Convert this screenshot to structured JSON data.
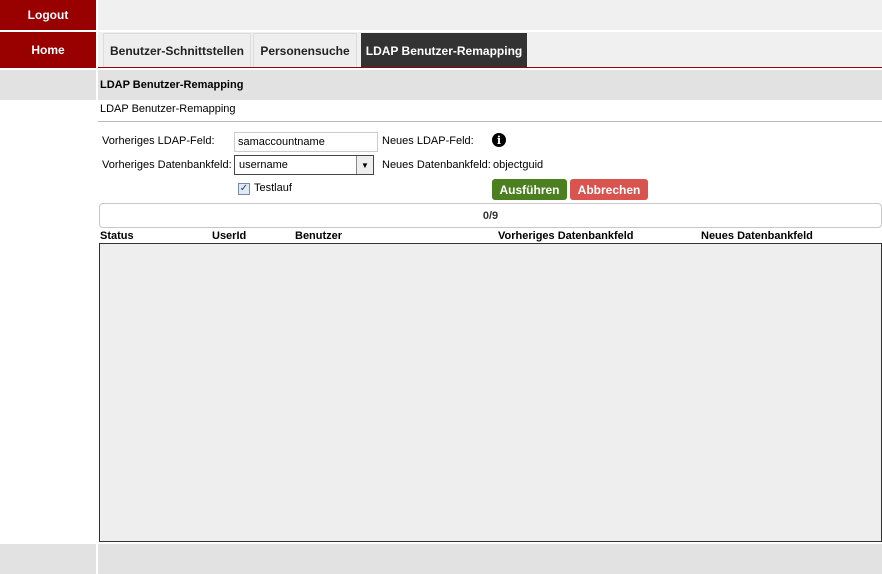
{
  "sidebar": {
    "logout_label": "Logout",
    "home_label": "Home"
  },
  "tabs": [
    {
      "label": "Benutzer-Schnittstellen",
      "active": false
    },
    {
      "label": "Personensuche",
      "active": false
    },
    {
      "label": "LDAP Benutzer-Remapping",
      "active": true
    }
  ],
  "page": {
    "header": "LDAP Benutzer-Remapping",
    "subtitle": "LDAP Benutzer-Remapping"
  },
  "form": {
    "prev_ldap_label": "Vorheriges LDAP-Feld:",
    "prev_ldap_value": "samaccountname",
    "new_ldap_label": "Neues LDAP-Feld:",
    "new_ldap_icon": "info-icon",
    "prev_db_label": "Vorheriges Datenbankfeld:",
    "prev_db_selected": "username",
    "new_db_label": "Neues Datenbankfeld:",
    "new_db_value": "objectguid",
    "testrun_label": "Testlauf",
    "testrun_checked": true,
    "run_label": "Ausführen",
    "cancel_label": "Abbrechen"
  },
  "progress": {
    "text": "0/9"
  },
  "results": {
    "columns": [
      "Status",
      "UserId",
      "Benutzer",
      "Vorheriges Datenbankfeld",
      "Neues Datenbankfeld"
    ],
    "rows": []
  },
  "colors": {
    "brand_red": "#990000",
    "active_tab": "#333333",
    "run_button": "#4b7f1f",
    "cancel_button": "#d9534f"
  }
}
